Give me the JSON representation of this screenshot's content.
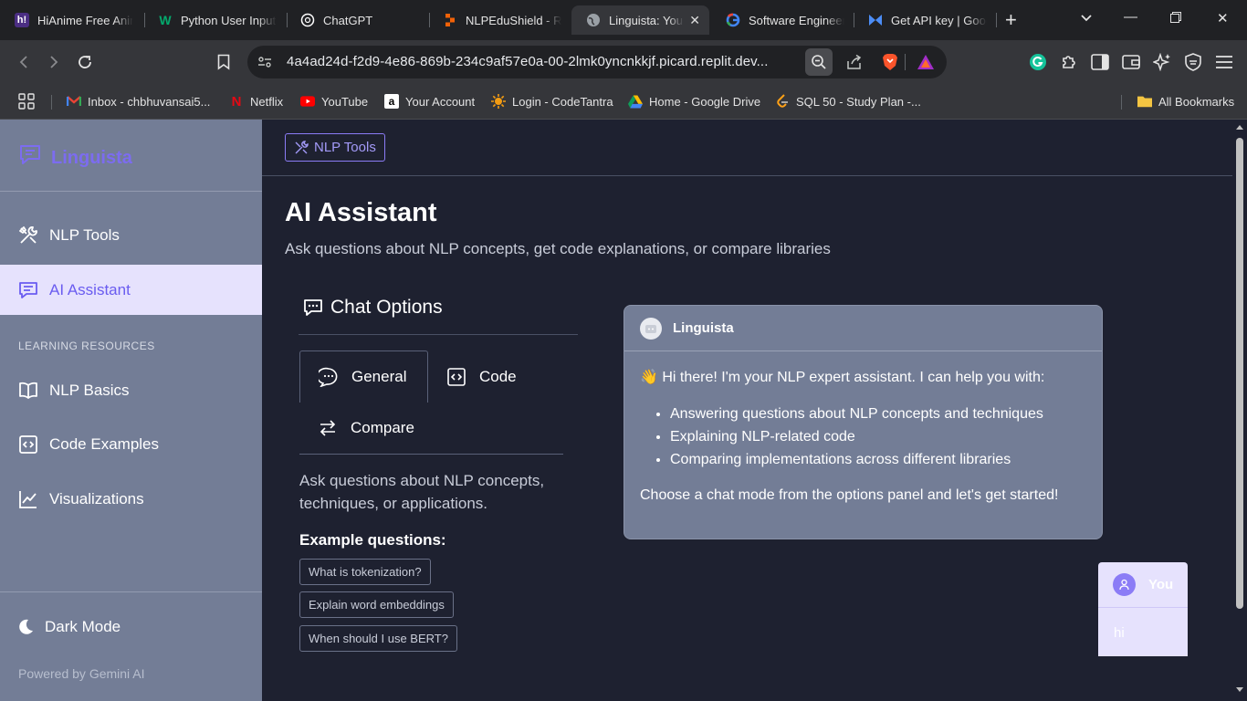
{
  "browser": {
    "tabs": [
      {
        "title": "HiAnime Free Anime",
        "icon": "hianime-icon"
      },
      {
        "title": "Python User Input",
        "icon": "w3schools-icon"
      },
      {
        "title": "ChatGPT",
        "icon": "chatgpt-icon"
      },
      {
        "title": "NLPEduShield - Replit",
        "icon": "replit-icon"
      },
      {
        "title": "Linguista: Your NLP",
        "icon": "globe-icon",
        "active": true
      },
      {
        "title": "Software Engineer",
        "icon": "google-icon"
      },
      {
        "title": "Get API key | Google",
        "icon": "ai-studio-icon"
      }
    ],
    "new_tab": "+",
    "url": "4a4ad24d-f2d9-4e86-869b-234c9af57e0a-00-2lmk0yncnkkjf.picard.replit.dev...",
    "bookmarks": [
      {
        "label": "Inbox - chbhuvansai5...",
        "icon": "gmail-icon"
      },
      {
        "label": "Netflix",
        "icon": "netflix-icon"
      },
      {
        "label": "YouTube",
        "icon": "youtube-icon"
      },
      {
        "label": "Your Account",
        "icon": "amazon-icon"
      },
      {
        "label": "Login - CodeTantra",
        "icon": "codetantra-icon"
      },
      {
        "label": "Home - Google Drive",
        "icon": "drive-icon"
      },
      {
        "label": "SQL 50 - Study Plan -...",
        "icon": "leetcode-icon"
      }
    ],
    "all_bookmarks": "All Bookmarks"
  },
  "sidebar": {
    "logo": "Linguista",
    "items": [
      {
        "label": "NLP Tools",
        "icon": "tools-icon"
      },
      {
        "label": "AI Assistant",
        "icon": "chat-icon",
        "active": true
      }
    ],
    "section_title": "LEARNING RESOURCES",
    "resources": [
      {
        "label": "NLP Basics",
        "icon": "book-icon"
      },
      {
        "label": "Code Examples",
        "icon": "code-icon"
      },
      {
        "label": "Visualizations",
        "icon": "chart-icon"
      }
    ],
    "dark_mode": "Dark Mode",
    "powered_by": "Powered by Gemini AI"
  },
  "main": {
    "breadcrumb": "NLP Tools",
    "title": "AI Assistant",
    "subtitle": "Ask questions about NLP concepts, get code explanations, or compare libraries",
    "options": {
      "title": "Chat Options",
      "modes": [
        "General",
        "Code",
        "Compare"
      ],
      "active_mode": "General",
      "description": "Ask questions about NLP concepts, techniques, or applications.",
      "examples_title": "Example questions:",
      "examples": [
        "What is tokenization?",
        "Explain word embeddings",
        "When should I use BERT?"
      ]
    },
    "chat": {
      "bot_name": "Linguista",
      "greeting": "👋 Hi there! I'm your NLP expert assistant. I can help you with:",
      "capabilities": [
        "Answering questions about NLP concepts and techniques",
        "Explaining NLP-related code",
        "Comparing implementations across different libraries"
      ],
      "closing": "Choose a chat mode from the options panel and let's get started!",
      "user_name": "You",
      "user_message": "hi"
    }
  },
  "colors": {
    "accent": "#8b7cf6",
    "sidebar_bg": "#737d96",
    "main_bg": "#1e2130",
    "active_item_bg": "#e6e2fd"
  }
}
